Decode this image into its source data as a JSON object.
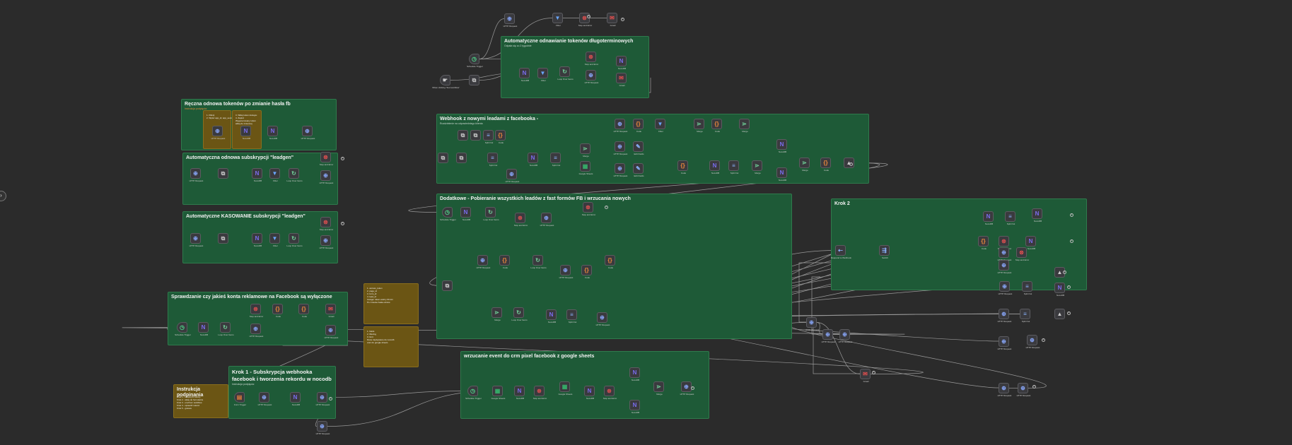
{
  "stickies": [
    {
      "id": "s-tokens",
      "title": "Automatyczne odnawianie tokenów długoterminowych",
      "subtitle": "Odpala się co 2 tygodnie"
    },
    {
      "id": "s-manual",
      "title": "Ręczna odnowa tokenów po zmianie hasła fb",
      "subtitle": "Instrukcja podpięcia:"
    },
    {
      "id": "s-note1",
      "title": "",
      "note": "1. Kliknij\n2. Wpisz app_id, app_secret"
    },
    {
      "id": "s-note2",
      "title": "",
      "note": "3. Wklej token dostępu\n4. Zapisz\nWygenerowany token\nwklej do zmiennej"
    },
    {
      "id": "s-subs",
      "title": "Automatyczna odnowa subskrypcji \"leadgen\""
    },
    {
      "id": "s-kas",
      "title": "Automatyczne KASOWANIE subskrypcji \"leadgen\""
    },
    {
      "id": "s-webhook",
      "title": "Webhook z nowymi leadami z facebooka -",
      "subtitle": "Rozdzielenie na odpowiedniego klienta"
    },
    {
      "id": "s-dodatkowe",
      "title": "Dodatkowe - Pobieranie wszystkich leadów z fast formów FB i wrzucania nowych"
    },
    {
      "id": "s-krok2",
      "title": "Krok 2"
    },
    {
      "id": "s-konta",
      "title": "Sprawdzanie czy jakieś konta reklamowe na Facebook są wyłączone"
    },
    {
      "id": "s-krok1",
      "title": "Krok 1 - Subskrypcja webhooka facebook i tworzenia rekordu w nocodb",
      "subtitle": "Instrukcja podpięcia:"
    },
    {
      "id": "s-instr",
      "title": "Instrukcja podpinania",
      "note": "Krok 1 - skopiuj ID strony\nKrok 2 - wklej do formularza\nKrok 3 - uruchom workflow\nKrok 4 - sprawdź rekord\nKrok 5 - gotowe"
    },
    {
      "id": "s-crm",
      "title": "wrzucanie event do crm pixel facebook z google sheets"
    },
    {
      "id": "s-y1",
      "title": "",
      "note": "1. access_token\n2. page_id\n3. form_id\n4. lead_id\nUwaga: token ważny 60 dni\nPo zmianie hasła odnów"
    },
    {
      "id": "s-y2",
      "title": "",
      "note": "1. fields\n2. filtering\n3. limit\nDane zapisywane do nocodb\noraz do google sheets"
    }
  ],
  "node_labels": {
    "schedule": "Schedule Trigger",
    "manual": "When clicking 'Test workflow'",
    "nocodb": "NocoDB",
    "http": "HTTP Request",
    "code": "Code",
    "if": "If",
    "filter": "Filter",
    "loop": "Loop Over Items",
    "set": "Edit Fields",
    "webhook": "Webhook",
    "sheets": "Google Sheets",
    "gmail": "Gmail",
    "switch": "Switch",
    "merge": "Merge",
    "wait": "Wait",
    "respond": "Respond to Webhook",
    "split": "Split Out",
    "stop": "Stop and Error",
    "exec": "Execute Workflow Trigger",
    "form": "Form Trigger"
  },
  "colors": {
    "canvas": "#2b2b2b",
    "sticky_green": "#1e5a37",
    "sticky_yellow": "#6b5514",
    "node": "#3a3a3e",
    "edge": "#9a9a9a"
  },
  "ui": {
    "collapse_icon": "chevron-right-icon",
    "collapse_glyph": "›"
  }
}
